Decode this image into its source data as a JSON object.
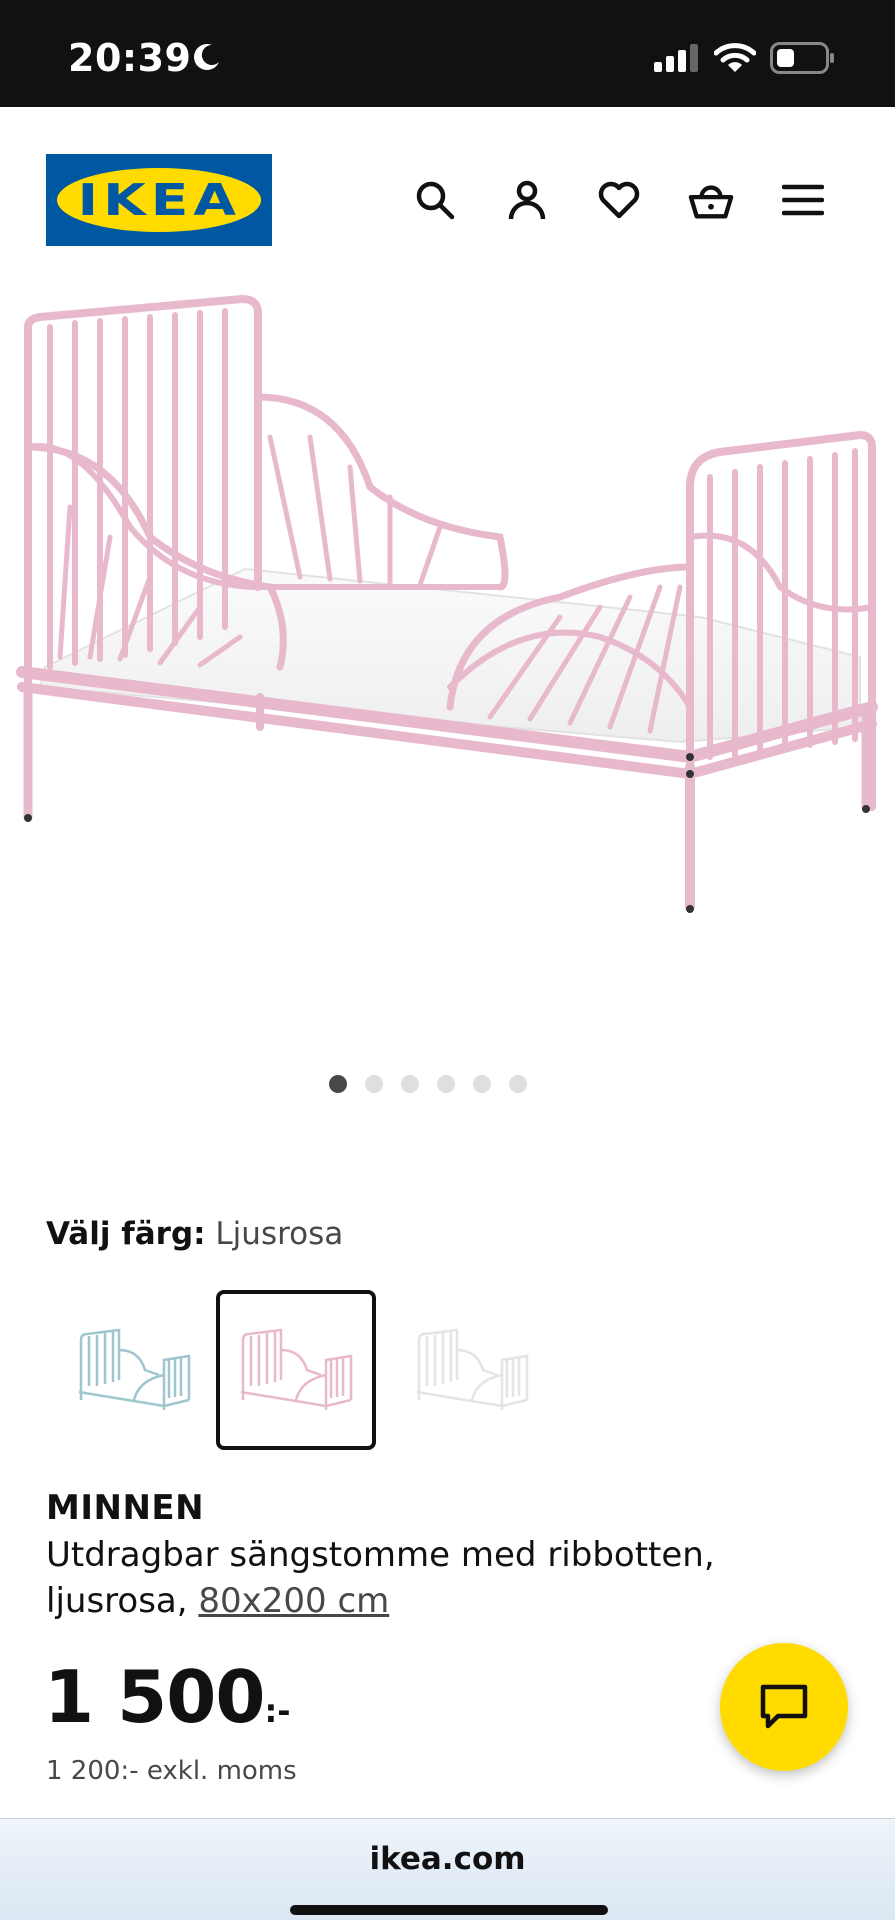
{
  "status_bar": {
    "time": "20:39",
    "icons": [
      "moon-icon",
      "signal-icon",
      "wifi-icon",
      "battery-icon"
    ]
  },
  "header": {
    "logo_text": "IKEA",
    "icons": [
      "search-icon",
      "user-icon",
      "heart-icon",
      "basket-icon",
      "menu-icon"
    ]
  },
  "product_image": {
    "carousel": {
      "total": 6,
      "active": 1
    }
  },
  "color_select": {
    "label": "Välj färg:",
    "value": "Ljusrosa",
    "options": [
      {
        "color": "#9ec6cf",
        "selected": false
      },
      {
        "color": "#e8b9cc",
        "selected": true
      },
      {
        "color": "#e9e9e9",
        "selected": false
      }
    ]
  },
  "product": {
    "name": "MINNEN",
    "description": "Utdragbar sängstomme med ribbotten, ljusrosa,",
    "size": "80x200 cm",
    "price": "1 500",
    "price_suffix": ":-",
    "price_excl": "1 200:- exkl. moms"
  },
  "browser": {
    "url": "ikea.com"
  },
  "colors": {
    "brand_blue": "#0058a3",
    "brand_yellow": "#ffdb00",
    "bed_pink": "#e8b9cc"
  }
}
